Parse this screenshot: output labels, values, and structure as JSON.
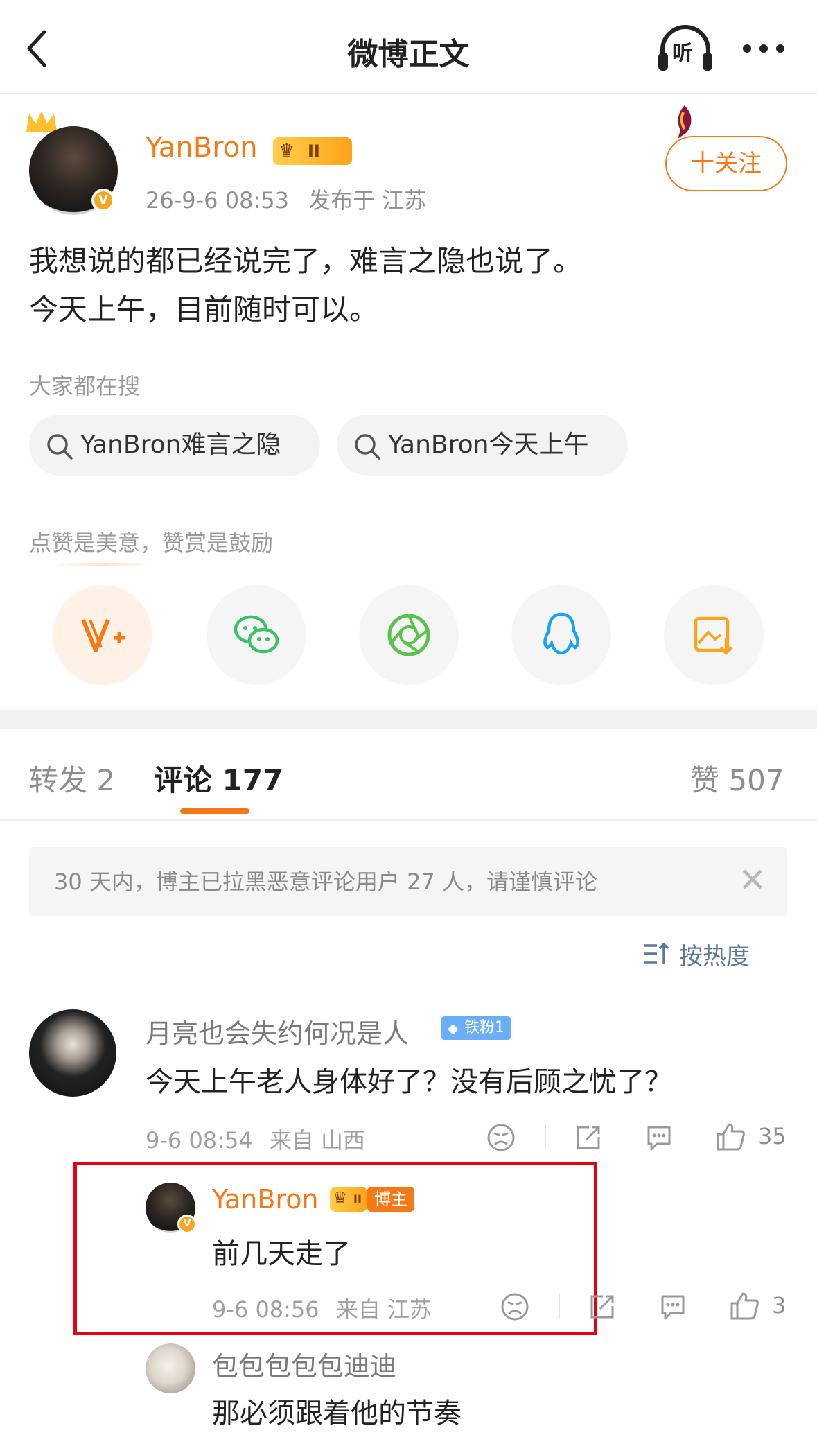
{
  "header": {
    "title": "微博正文",
    "listen_label": "听",
    "more_icon": "more-icon",
    "back_icon": "back-icon"
  },
  "post": {
    "author": "YanBron",
    "vip_level": "II",
    "verified_mark": "V",
    "time": "26-9-6 08:53",
    "location": "发布于 江苏",
    "follow_label": "十关注",
    "text_line1": "我想说的都已经说完了，难言之隐也说了。",
    "text_line2": "今天上午，目前随时可以。"
  },
  "searches": {
    "label": "大家都在搜",
    "items": [
      "YanBron难言之隐",
      "YanBron今天上午"
    ]
  },
  "share": {
    "label": "点赞是美意，赞赏是鼓励",
    "icons": [
      "vplus-icon",
      "wechat-icon",
      "moments-icon",
      "qq-icon",
      "save-image-icon"
    ]
  },
  "tabs": {
    "repost": "转发 2",
    "comment": "评论 177",
    "like": "赞 507"
  },
  "notice": {
    "text": "30 天内，博主已拉黑恶意评论用户 27 人，请谨慎评论",
    "close": "✕"
  },
  "sort": {
    "label": "按热度"
  },
  "comments": [
    {
      "name": "月亮也会失约何况是人",
      "badge": "铁粉1",
      "text": "今天上午老人身体好了？没有后顾之忧了？",
      "time": "9-6 08:54",
      "location": "来自 山西",
      "likes": "35"
    }
  ],
  "reply": {
    "name": "YanBron",
    "badge": "博主",
    "vip_level": "II",
    "text": "前几天走了",
    "time": "9-6 08:56",
    "location": "来自 江苏",
    "likes": "3"
  },
  "next_comment": {
    "name": "包包包包包迪迪",
    "text": "那必须跟着他的节奏"
  },
  "colors": {
    "accent": "#f57a17",
    "link": "#5c7799",
    "highlight": "#e60012"
  }
}
